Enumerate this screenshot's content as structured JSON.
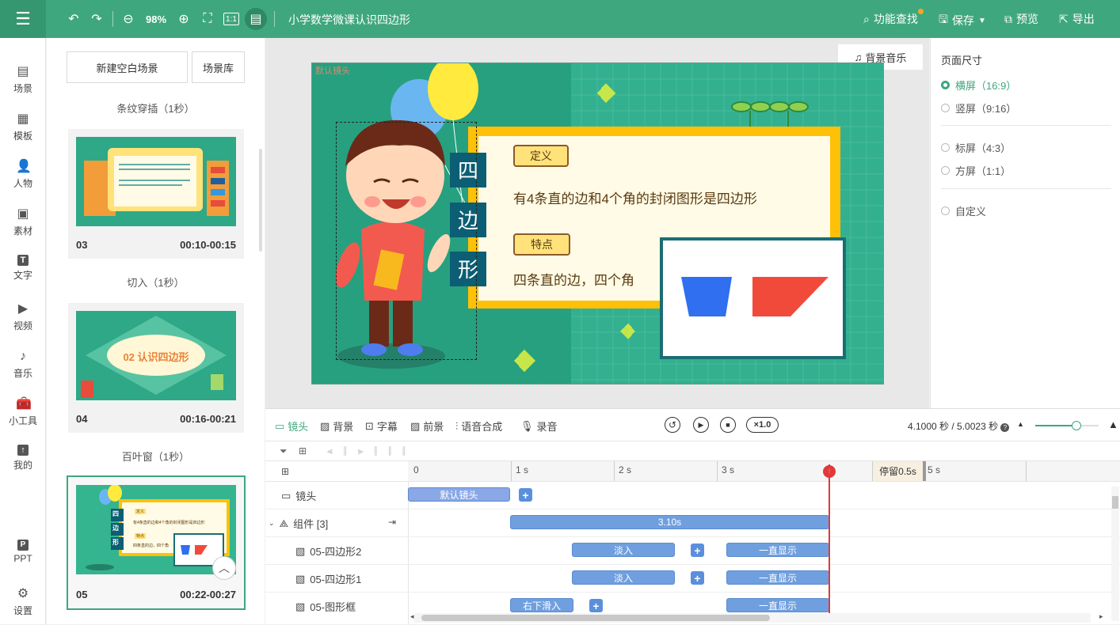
{
  "topbar": {
    "zoom": "98%",
    "title": "小学数学微课认识四边形",
    "find_label": "功能查找",
    "save_label": "保存",
    "preview_label": "预览",
    "export_label": "导出"
  },
  "sidebar": {
    "items": [
      {
        "label": "场景",
        "icon": "scene-icon"
      },
      {
        "label": "模板",
        "icon": "template-icon"
      },
      {
        "label": "人物",
        "icon": "person-icon"
      },
      {
        "label": "素材",
        "icon": "material-icon"
      },
      {
        "label": "文字",
        "icon": "text-icon"
      },
      {
        "label": "视频",
        "icon": "video-icon"
      },
      {
        "label": "音乐",
        "icon": "music-icon"
      },
      {
        "label": "小工具",
        "icon": "toolbox-icon"
      },
      {
        "label": "我的",
        "icon": "upload-icon"
      },
      {
        "label": "PPT",
        "icon": "ppt-icon"
      },
      {
        "label": "设置",
        "icon": "gear-icon"
      }
    ]
  },
  "scenes": {
    "new_blank_label": "新建空白场景",
    "library_label": "场景库",
    "items": [
      {
        "transition": "条纹穿插（1秒）",
        "num": "03",
        "time": "00:10-00:15"
      },
      {
        "transition": "切入（1秒）",
        "num": "04",
        "time": "00:16-00:21",
        "thumb_text": "02 认识四边形"
      },
      {
        "transition": "百叶窗（1秒）",
        "num": "05",
        "time": "00:22-00:27"
      }
    ],
    "thumb3": {
      "a": "定义",
      "b": "有4条直的边和4个角的封闭图形是四边形",
      "c": "特点",
      "d": "四条直的边，四个角",
      "v": [
        "四",
        "边",
        "形"
      ]
    }
  },
  "canvas": {
    "bgm_label": "背景音乐",
    "camera_tag": "默认镜头",
    "vertical_title": [
      "四",
      "边",
      "形"
    ],
    "def_tag": "定义",
    "def_text": "有4条直的边和4个角的封闭图形是四边形",
    "feat_tag": "特点",
    "feat_text": "四条直的边，四个角"
  },
  "rightpanel": {
    "title": "页面尺寸",
    "options": [
      {
        "label": "横屏（16:9）",
        "selected": true
      },
      {
        "label": "竖屏（9:16）",
        "selected": false
      },
      {
        "label": "标屏（4:3）",
        "selected": false
      },
      {
        "label": "方屏（1:1）",
        "selected": false
      },
      {
        "label": "自定义",
        "selected": false
      }
    ]
  },
  "timeline": {
    "tabs": [
      "镜头",
      "背景",
      "字幕",
      "前景",
      "语音合成",
      "录音"
    ],
    "speed": "×1.0",
    "time_readout": "4.1000 秒 / 5.0023 秒",
    "ruler": [
      "0",
      "1 s",
      "2 s",
      "3 s",
      "5 s"
    ],
    "pause_label": "停留0.5s",
    "rows": [
      {
        "label": "镜头",
        "bar": "默认镜头"
      },
      {
        "label": "组件 [3]",
        "bar": "3.10s"
      },
      {
        "label": "05-四边形2",
        "in": "淡入",
        "stay": "一直显示"
      },
      {
        "label": "05-四边形1",
        "in": "淡入",
        "stay": "一直显示"
      },
      {
        "label": "05-图形框",
        "in": "右下滑入",
        "stay": "一直显示"
      }
    ]
  }
}
